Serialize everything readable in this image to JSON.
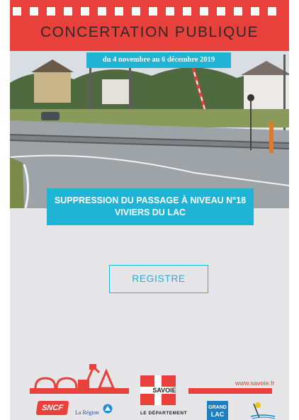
{
  "header": {
    "title": "CONCERTATION PUBLIQUE",
    "dates": "du 4 novembre au 6 décembre 2019"
  },
  "project": {
    "title_line1": "SUPPRESSION DU PASSAGE À NIVEAU N°18",
    "title_line2": "VIVIERS DU LAC"
  },
  "actions": {
    "registre_label": "REGISTRE"
  },
  "footer": {
    "website": "www.savoie.fr",
    "savoie_logo_text": "SAVOIE",
    "departement_text": "LE DÉPARTEMENT",
    "sncf_text": "SNCF",
    "region_text": "La Région",
    "grand_lac_line1": "GRAND",
    "grand_lac_line2": "LAC"
  },
  "colors": {
    "brand_red": "#e8403a",
    "accent_cyan": "#1fb3d6",
    "background_gray": "#e6e6e8"
  }
}
